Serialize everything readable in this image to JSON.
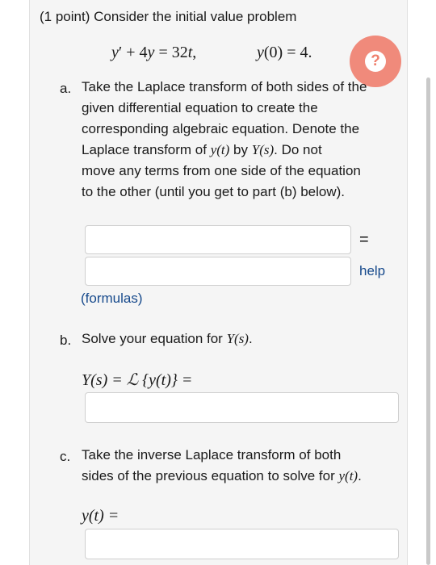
{
  "problem": {
    "header": "(1 point) Consider the initial value problem",
    "equation": {
      "y": "y",
      "prime": "′",
      "plus": "+ 4",
      "y2": "y",
      "eq": "= 32",
      "t": "t",
      "comma": ","
    },
    "initial": {
      "y": "y",
      "open": "(0) = 4."
    }
  },
  "help_fab": {
    "icon": "question-icon",
    "glyph": "?"
  },
  "part_a": {
    "marker": "a.",
    "lines": [
      "Take the Laplace transform of both sides of the",
      "given differential equation to create the",
      "corresponding algebraic equation. Denote the",
      "Laplace transform of",
      "by",
      ". Do not",
      "move any terms from one side of the equation",
      "to the other (until you get to part (b) below)."
    ],
    "y_t": "y(t)",
    "Y_s": "Y(s)",
    "equals_sign": "=",
    "help_link": "help",
    "formulas_link": "(formulas)"
  },
  "part_b": {
    "marker": "b.",
    "text": "Solve your equation for",
    "Y_s": "Y(s)",
    "period": ".",
    "answer_label": "Y(s) = ℒ {y(t)} ="
  },
  "part_c": {
    "marker": "c.",
    "line1": "Take the inverse Laplace transform of both",
    "line2": "sides of the previous equation to solve for",
    "y_t": "y(t)",
    "period": ".",
    "answer_label": "y(t) ="
  },
  "colors": {
    "accent": "#f08a7b",
    "link": "#174a8c",
    "panel": "#f5f5f5"
  }
}
